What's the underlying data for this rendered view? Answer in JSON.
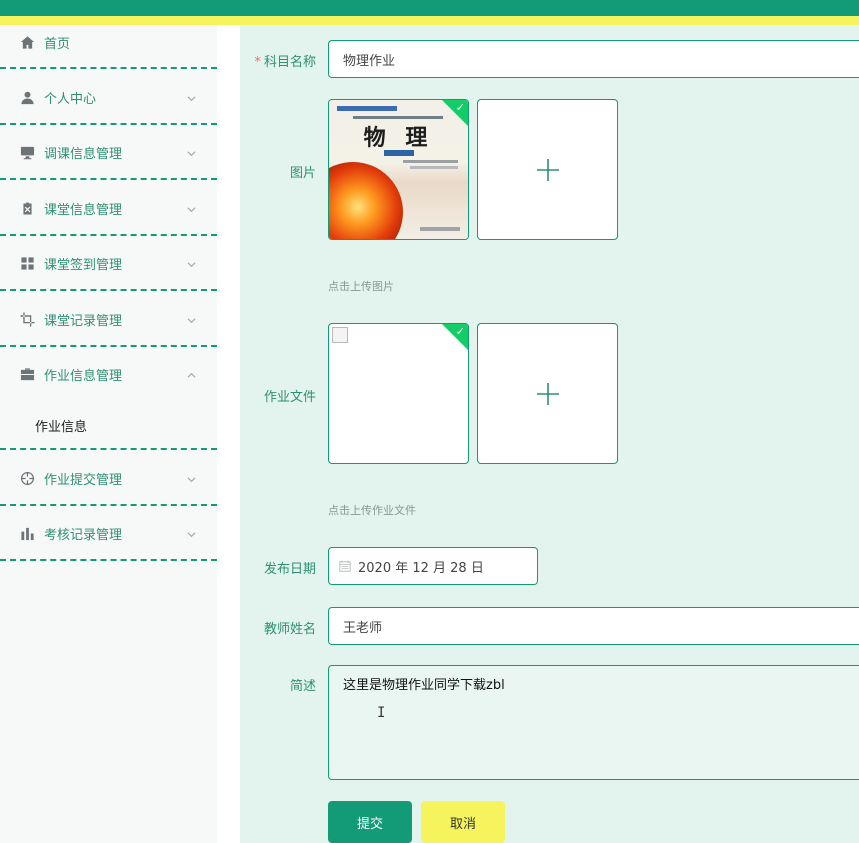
{
  "sidebar": {
    "items": [
      {
        "label": "首页",
        "icon": "home-icon"
      },
      {
        "label": "个人中心",
        "icon": "user-icon"
      },
      {
        "label": "调课信息管理",
        "icon": "monitor-icon"
      },
      {
        "label": "课堂信息管理",
        "icon": "clipboard-icon"
      },
      {
        "label": "课堂签到管理",
        "icon": "grid-icon"
      },
      {
        "label": "课堂记录管理",
        "icon": "crop-icon"
      },
      {
        "label": "作业信息管理",
        "icon": "briefcase-icon",
        "expanded": true,
        "children": [
          {
            "label": "作业信息"
          }
        ]
      },
      {
        "label": "作业提交管理",
        "icon": "crosshair-icon"
      },
      {
        "label": "考核记录管理",
        "icon": "bar-chart-icon"
      }
    ]
  },
  "form": {
    "subject": {
      "label": "科目名称",
      "value": "物理作业",
      "required": true
    },
    "image": {
      "label": "图片",
      "tip": "点击上传图片",
      "book_title": "物 理"
    },
    "file": {
      "label": "作业文件",
      "tip": "点击上传作业文件"
    },
    "date": {
      "label": "发布日期",
      "value": "2020 年 12 月 28 日"
    },
    "teacher": {
      "label": "教师姓名",
      "value": "王老师"
    },
    "description": {
      "label": "简述",
      "value": "这里是物理作业同学下载zbl"
    },
    "submit_label": "提交",
    "cancel_label": "取消"
  },
  "colors": {
    "primary": "#129b76",
    "accent_yellow": "#f6f45c",
    "background": "#e3f4ee"
  }
}
